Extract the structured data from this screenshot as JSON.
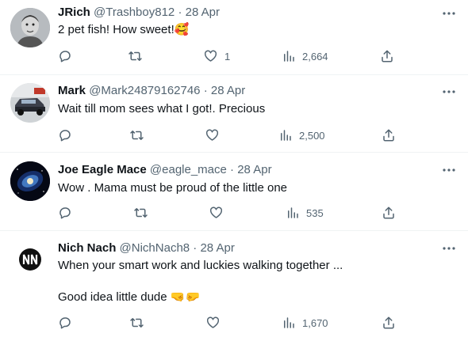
{
  "tweets": [
    {
      "name": "JRich",
      "handle": "@Trashboy812",
      "separator": "·",
      "time": "28 Apr",
      "text_lines": [
        "2 pet fish!  How sweet!🥰"
      ],
      "replies": "",
      "reposts": "",
      "likes": "1",
      "views": "2,664"
    },
    {
      "name": "Mark",
      "handle": "@Mark24879162746",
      "separator": "·",
      "time": "28 Apr",
      "text_lines": [
        "Wait till mom sees what I got!. Precious"
      ],
      "replies": "",
      "reposts": "",
      "likes": "",
      "views": "2,500"
    },
    {
      "name": "Joe Eagle Mace",
      "handle": "@eagle_mace",
      "separator": "·",
      "time": "28 Apr",
      "text_lines": [
        "Wow . Mama must be proud of the little one"
      ],
      "replies": "",
      "reposts": "",
      "likes": "",
      "views": "535"
    },
    {
      "name": "Nich Nach",
      "handle": "@NichNach8",
      "separator": "·",
      "time": "28 Apr",
      "text_lines": [
        "When your smart work and luckies walking together ...",
        "",
        "Good idea little dude 🤜🤛"
      ],
      "replies": "",
      "reposts": "",
      "likes": "",
      "views": "1,670"
    }
  ],
  "icons": {
    "reply": "reply-icon",
    "repost": "repost-icon",
    "like": "like-icon",
    "views": "views-icon",
    "share": "share-icon",
    "more": "more-icon"
  },
  "colors": {
    "text": "#0f1419",
    "secondary": "#536471",
    "divider": "#eff3f4",
    "icon": "#536471"
  }
}
